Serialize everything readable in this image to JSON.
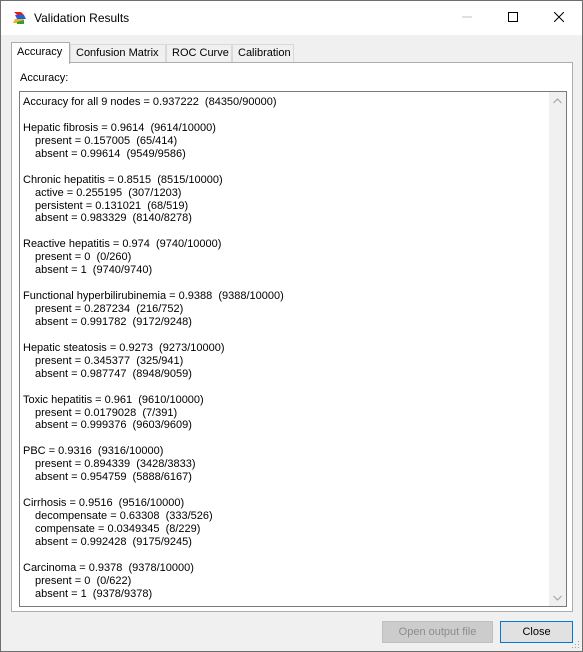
{
  "window": {
    "title": "Validation Results"
  },
  "tabs": [
    {
      "label": "Accuracy"
    },
    {
      "label": "Confusion Matrix"
    },
    {
      "label": "ROC Curve"
    },
    {
      "label": "Calibration"
    }
  ],
  "panel": {
    "label": "Accuracy:"
  },
  "results": [
    {
      "text": "Accuracy for all 9 nodes = 0.937222  (84350/90000)",
      "indent": false
    },
    {
      "text": "",
      "indent": false
    },
    {
      "text": "Hepatic fibrosis = 0.9614  (9614/10000)",
      "indent": false
    },
    {
      "text": "present = 0.157005  (65/414)",
      "indent": true
    },
    {
      "text": "absent = 0.99614  (9549/9586)",
      "indent": true
    },
    {
      "text": "",
      "indent": false
    },
    {
      "text": "Chronic hepatitis = 0.8515  (8515/10000)",
      "indent": false
    },
    {
      "text": "active = 0.255195  (307/1203)",
      "indent": true
    },
    {
      "text": "persistent = 0.131021  (68/519)",
      "indent": true
    },
    {
      "text": "absent = 0.983329  (8140/8278)",
      "indent": true
    },
    {
      "text": "",
      "indent": false
    },
    {
      "text": "Reactive hepatitis = 0.974  (9740/10000)",
      "indent": false
    },
    {
      "text": "present = 0  (0/260)",
      "indent": true
    },
    {
      "text": "absent = 1  (9740/9740)",
      "indent": true
    },
    {
      "text": "",
      "indent": false
    },
    {
      "text": "Functional hyperbilirubinemia = 0.9388  (9388/10000)",
      "indent": false
    },
    {
      "text": "present = 0.287234  (216/752)",
      "indent": true
    },
    {
      "text": "absent = 0.991782  (9172/9248)",
      "indent": true
    },
    {
      "text": "",
      "indent": false
    },
    {
      "text": "Hepatic steatosis = 0.9273  (9273/10000)",
      "indent": false
    },
    {
      "text": "present = 0.345377  (325/941)",
      "indent": true
    },
    {
      "text": "absent = 0.987747  (8948/9059)",
      "indent": true
    },
    {
      "text": "",
      "indent": false
    },
    {
      "text": "Toxic hepatitis = 0.961  (9610/10000)",
      "indent": false
    },
    {
      "text": "present = 0.0179028  (7/391)",
      "indent": true
    },
    {
      "text": "absent = 0.999376  (9603/9609)",
      "indent": true
    },
    {
      "text": "",
      "indent": false
    },
    {
      "text": "PBC = 0.9316  (9316/10000)",
      "indent": false
    },
    {
      "text": "present = 0.894339  (3428/3833)",
      "indent": true
    },
    {
      "text": "absent = 0.954759  (5888/6167)",
      "indent": true
    },
    {
      "text": "",
      "indent": false
    },
    {
      "text": "Cirrhosis = 0.9516  (9516/10000)",
      "indent": false
    },
    {
      "text": "decompensate = 0.63308  (333/526)",
      "indent": true
    },
    {
      "text": "compensate = 0.0349345  (8/229)",
      "indent": true
    },
    {
      "text": "absent = 0.992428  (9175/9245)",
      "indent": true
    },
    {
      "text": "",
      "indent": false
    },
    {
      "text": "Carcinoma = 0.9378  (9378/10000)",
      "indent": false
    },
    {
      "text": "present = 0  (0/622)",
      "indent": true
    },
    {
      "text": "absent = 1  (9378/9378)",
      "indent": true
    }
  ],
  "buttons": {
    "open_output": "Open output file",
    "close": "Close"
  },
  "icons": {
    "app": "app-icon",
    "minimize": "minimize-icon",
    "maximize": "maximize-icon",
    "close": "close-icon"
  },
  "colors": {
    "accent_border": "#0078d7"
  }
}
